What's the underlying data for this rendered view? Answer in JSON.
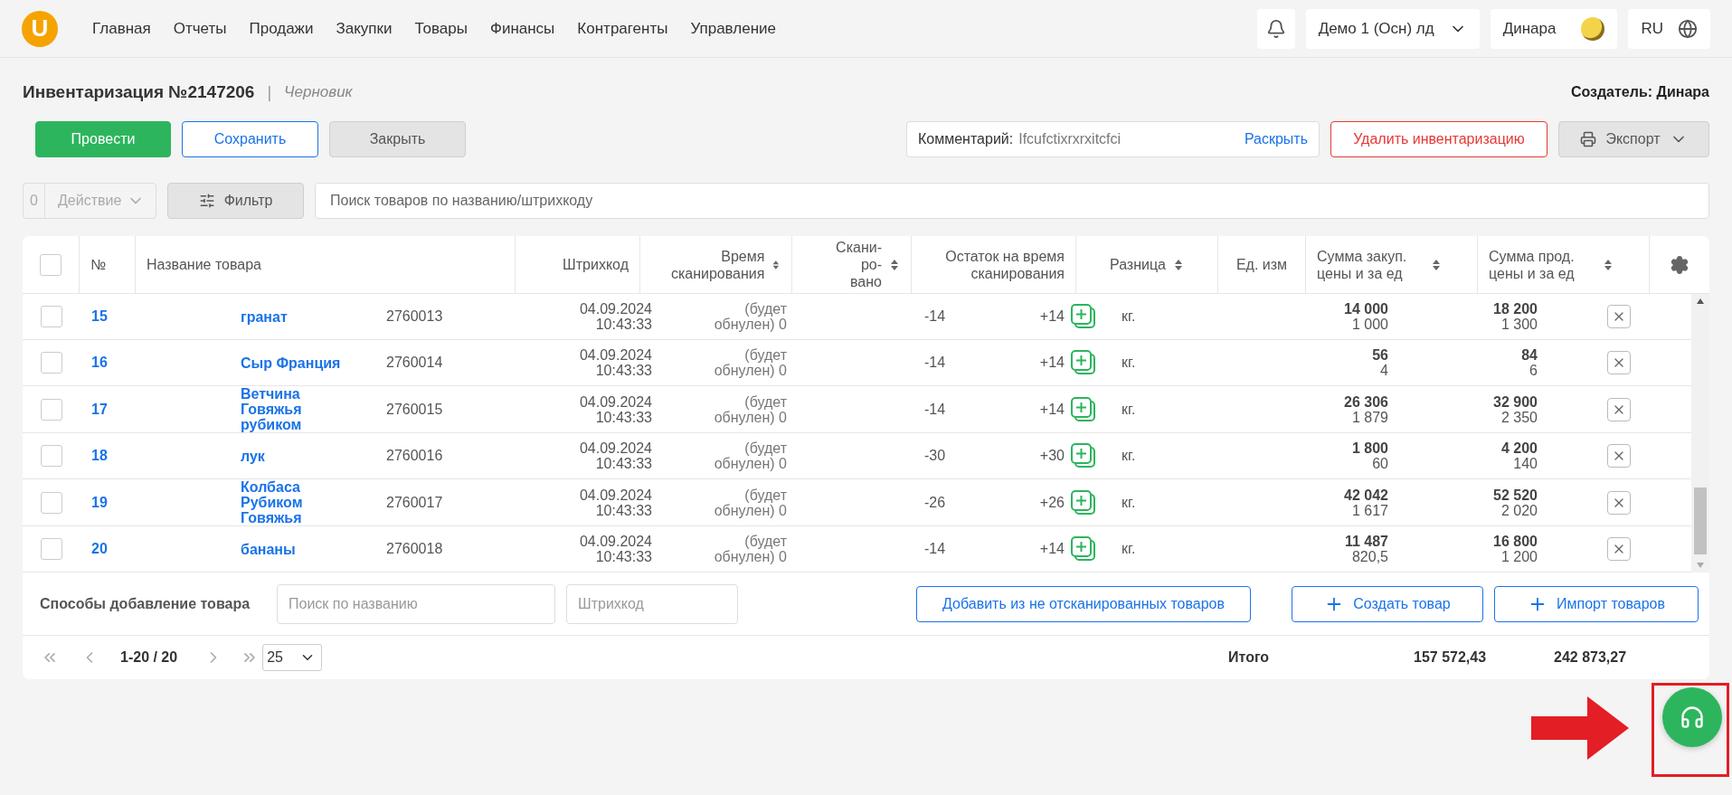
{
  "topbar": {
    "logo": "U",
    "nav": [
      {
        "label": "Главная",
        "selected": false
      },
      {
        "label": "Отчеты",
        "selected": false
      },
      {
        "label": "Продажи",
        "selected": false
      },
      {
        "label": "Закупки",
        "selected": false
      },
      {
        "label": "Товары",
        "selected": false
      },
      {
        "label": "Финансы",
        "selected": false
      },
      {
        "label": "Контрагенты",
        "selected": false
      },
      {
        "label": "Управление",
        "selected": false
      }
    ],
    "company": "Демо 1 (Осн) лд",
    "user": "Динара",
    "language": "RU"
  },
  "document": {
    "title": "Инвентаризация №2147206",
    "separator": "|",
    "status": "Черновик",
    "creator": "Создатель: Динара"
  },
  "actions": {
    "conduct": "Провести",
    "save": "Сохранить",
    "close": "Закрыть",
    "comment_label": "Комментарий:",
    "comment_value": "Ifcufctixrxrxitcfci",
    "expand": "Раскрыть",
    "delete": "Удалить инвентаризацию",
    "export": "Экспорт"
  },
  "toolbar": {
    "selected_count": "0",
    "action": "Действие",
    "action_disabled": true,
    "filter": "Фильтр",
    "search_placeholder": "Поиск товаров по названию/штрихкоду"
  },
  "table": {
    "all_checked": false,
    "columns": [
      {
        "label": "№",
        "sortable": false
      },
      {
        "label": "Название товара",
        "sortable": false
      },
      {
        "label": "Штрихкод",
        "sortable": false
      },
      {
        "label": "Время сканирования",
        "sortable": true
      },
      {
        "label": "Скани-ро-вано",
        "sortable": true
      },
      {
        "label": "Остаток на время сканирования",
        "sortable": false
      },
      {
        "label": "Разница",
        "sortable": true
      },
      {
        "label": "Ед. изм",
        "sortable": false
      },
      {
        "label": "Сумма закуп. цены и за ед",
        "sortable": true
      },
      {
        "label": "Сумма прод. цены и за ед",
        "sortable": true
      }
    ],
    "rows": [
      {
        "checked": false,
        "number": "15",
        "name": "гранат",
        "barcode": "2760013",
        "scan_time": "04.09.2024 10:43:33",
        "scanned": "(будет обнулен) 0",
        "stock": "-14",
        "difference": "+14",
        "unit": "кг.",
        "purchase_total": "14 000",
        "purchase_unit": "1 000",
        "sale_total": "18 200",
        "sale_unit": "1 300"
      },
      {
        "checked": false,
        "number": "16",
        "name": "Сыр Франция",
        "barcode": "2760014",
        "scan_time": "04.09.2024 10:43:33",
        "scanned": "(будет обнулен) 0",
        "stock": "-14",
        "difference": "+14",
        "unit": "кг.",
        "purchase_total": "56",
        "purchase_unit": "4",
        "sale_total": "84",
        "sale_unit": "6"
      },
      {
        "checked": false,
        "number": "17",
        "name": "Ветчина Говяжья рубиком",
        "barcode": "2760015",
        "scan_time": "04.09.2024 10:43:33",
        "scanned": "(будет обнулен) 0",
        "stock": "-14",
        "difference": "+14",
        "unit": "кг.",
        "purchase_total": "26 306",
        "purchase_unit": "1 879",
        "sale_total": "32 900",
        "sale_unit": "2 350"
      },
      {
        "checked": false,
        "number": "18",
        "name": "лук",
        "barcode": "2760016",
        "scan_time": "04.09.2024 10:43:33",
        "scanned": "(будет обнулен) 0",
        "stock": "-30",
        "difference": "+30",
        "unit": "кг.",
        "purchase_total": "1 800",
        "purchase_unit": "60",
        "sale_total": "4 200",
        "sale_unit": "140"
      },
      {
        "checked": false,
        "number": "19",
        "name": "Колбаса Рубиком Говяжья",
        "barcode": "2760017",
        "scan_time": "04.09.2024 10:43:33",
        "scanned": "(будет обнулен) 0",
        "stock": "-26",
        "difference": "+26",
        "unit": "кг.",
        "purchase_total": "42 042",
        "purchase_unit": "1 617",
        "sale_total": "52 520",
        "sale_unit": "2 020"
      },
      {
        "checked": false,
        "number": "20",
        "name": "бананы",
        "barcode": "2760018",
        "scan_time": "04.09.2024 10:43:33",
        "scanned": "(будет обнулен) 0",
        "stock": "-14",
        "difference": "+14",
        "unit": "кг.",
        "purchase_total": "11 487",
        "purchase_unit": "820,5",
        "sale_total": "16 800",
        "sale_unit": "1 200"
      }
    ]
  },
  "add_products": {
    "label": "Способы добавление товара",
    "name_placeholder": "Поиск по названию",
    "barcode_placeholder": "Штрихкод",
    "add_unscanned": "Добавить из не отсканированных товаров",
    "create": "Создать товар",
    "import": "Импорт товаров"
  },
  "footer": {
    "range": "1-20 / 20",
    "page_size": "25",
    "total_label": "Итого",
    "purchase_total": "157 572,43",
    "sale_total": "242 873,27"
  }
}
